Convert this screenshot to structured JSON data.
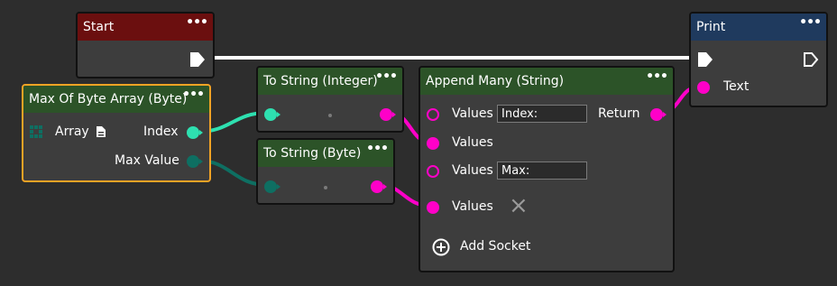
{
  "colors": {
    "background": "#2d2d2d",
    "node_body": "#3d3d3d",
    "header_event": "#6b0f0f",
    "header_function": "#2c5328",
    "header_print": "#1f3a5e",
    "selected_border": "#f3a325",
    "exec_wire": "#ffffff",
    "string_pin": "#ff00c8",
    "integer_pin": "#2ee0b0",
    "byte_pin": "#0e6f62"
  },
  "nodes": {
    "start": {
      "title": "Start",
      "menu": "•••"
    },
    "max_byte_array": {
      "title": "Max Of Byte Array (Byte)",
      "menu": "•••",
      "array_label": "Array",
      "index_label": "Index",
      "max_value_label": "Max Value"
    },
    "to_string_integer": {
      "title": "To String (Integer)",
      "menu": "•••"
    },
    "to_string_byte": {
      "title": "To String (Byte)",
      "menu": "•••"
    },
    "append_many": {
      "title": "Append Many (String)",
      "menu": "•••",
      "rows": [
        {
          "label": "Values",
          "value": "Index:"
        },
        {
          "label": "Values"
        },
        {
          "label": "Values",
          "value": "Max:"
        },
        {
          "label": "Values"
        }
      ],
      "return_label": "Return",
      "remove_icon": "×",
      "add_socket_label": "Add Socket"
    },
    "print": {
      "title": "Print",
      "menu": "•••",
      "text_label": "Text"
    }
  }
}
